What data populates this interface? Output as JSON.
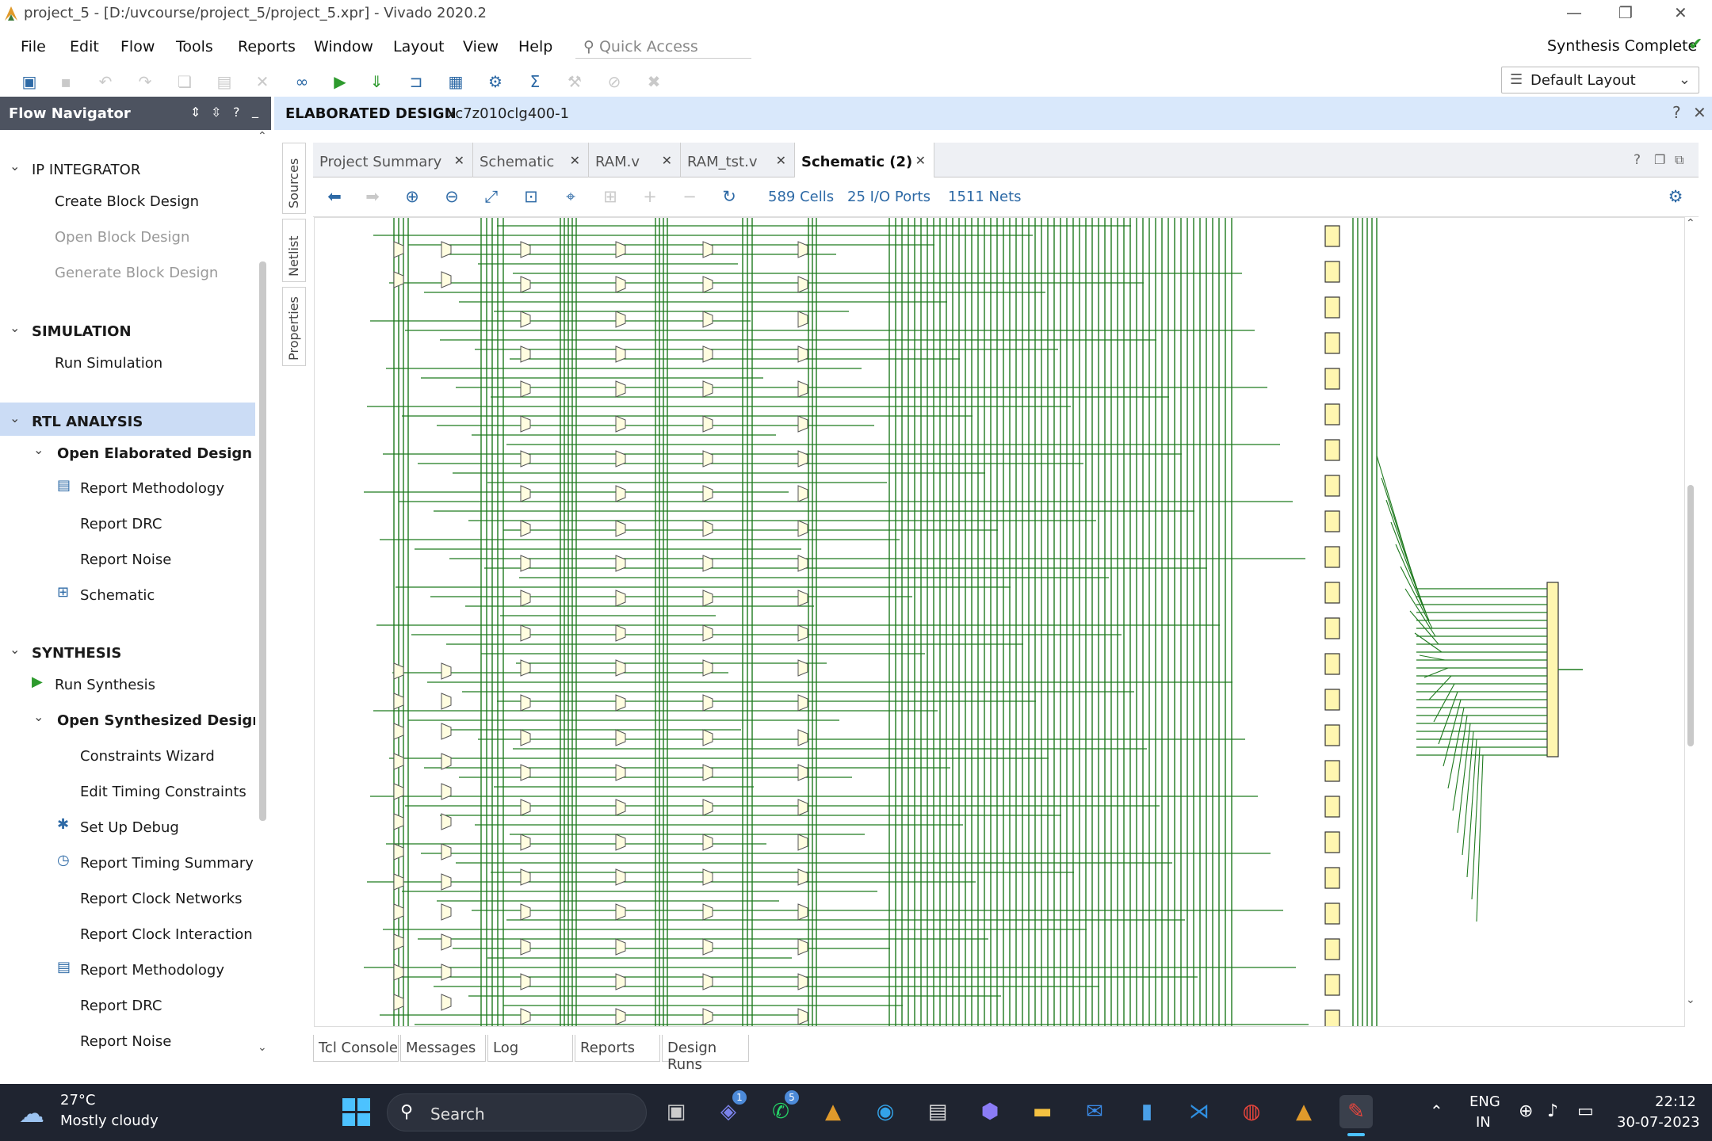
{
  "window": {
    "title": "project_5 - [D:/uvcourse/project_5/project_5.xpr] - Vivado 2020.2"
  },
  "menu": [
    "File",
    "Edit",
    "Flow",
    "Tools",
    "Reports",
    "Window",
    "Layout",
    "View",
    "Help"
  ],
  "quick_access": {
    "placeholder": "Quick Access"
  },
  "status": {
    "text": "Synthesis Complete"
  },
  "layout_select": {
    "value": "Default Layout"
  },
  "flow_navigator": {
    "title": "Flow Navigator",
    "sections": [
      {
        "label": "IP INTEGRATOR",
        "items": [
          "Create Block Design",
          "Open Block Design",
          "Generate Block Design"
        ]
      },
      {
        "label": "SIMULATION",
        "items": [
          "Run Simulation"
        ]
      },
      {
        "label": "RTL ANALYSIS",
        "sub": "Open Elaborated Design",
        "items": [
          "Report Methodology",
          "Report DRC",
          "Report Noise",
          "Schematic"
        ]
      },
      {
        "label": "SYNTHESIS",
        "run": "Run Synthesis",
        "sub": "Open Synthesized Design",
        "items": [
          "Constraints Wizard",
          "Edit Timing Constraints",
          "Set Up Debug",
          "Report Timing Summary",
          "Report Clock Networks",
          "Report Clock Interaction",
          "Report Methodology",
          "Report DRC",
          "Report Noise"
        ]
      }
    ]
  },
  "editor": {
    "title": "ELABORATED DESIGN",
    "part": "xc7z010clg400-1"
  },
  "side_tabs": [
    "Sources",
    "Netlist",
    "Properties"
  ],
  "tabs": [
    "Project Summary",
    "Schematic",
    "RAM.v",
    "RAM_tst.v",
    "Schematic (2)"
  ],
  "schematic_stats": {
    "cells": "589 Cells",
    "ports": "25 I/O Ports",
    "nets": "1511 Nets"
  },
  "bottom_tabs": [
    "Tcl Console",
    "Messages",
    "Log",
    "Reports",
    "Design Runs"
  ],
  "taskbar": {
    "weather_temp": "27°C",
    "weather_desc": "Mostly cloudy",
    "search": "Search",
    "lang1": "ENG",
    "lang2": "IN",
    "time": "22:12",
    "date": "30-07-2023",
    "badge_teams": "1",
    "badge_whatsapp": "5"
  },
  "colors": {
    "wire": "#1f7a1f",
    "accent": "#2e6aa6",
    "nav_selected": "#cbdcf5",
    "header_blue": "#d9e8fb",
    "taskbar": "#1f2430"
  }
}
